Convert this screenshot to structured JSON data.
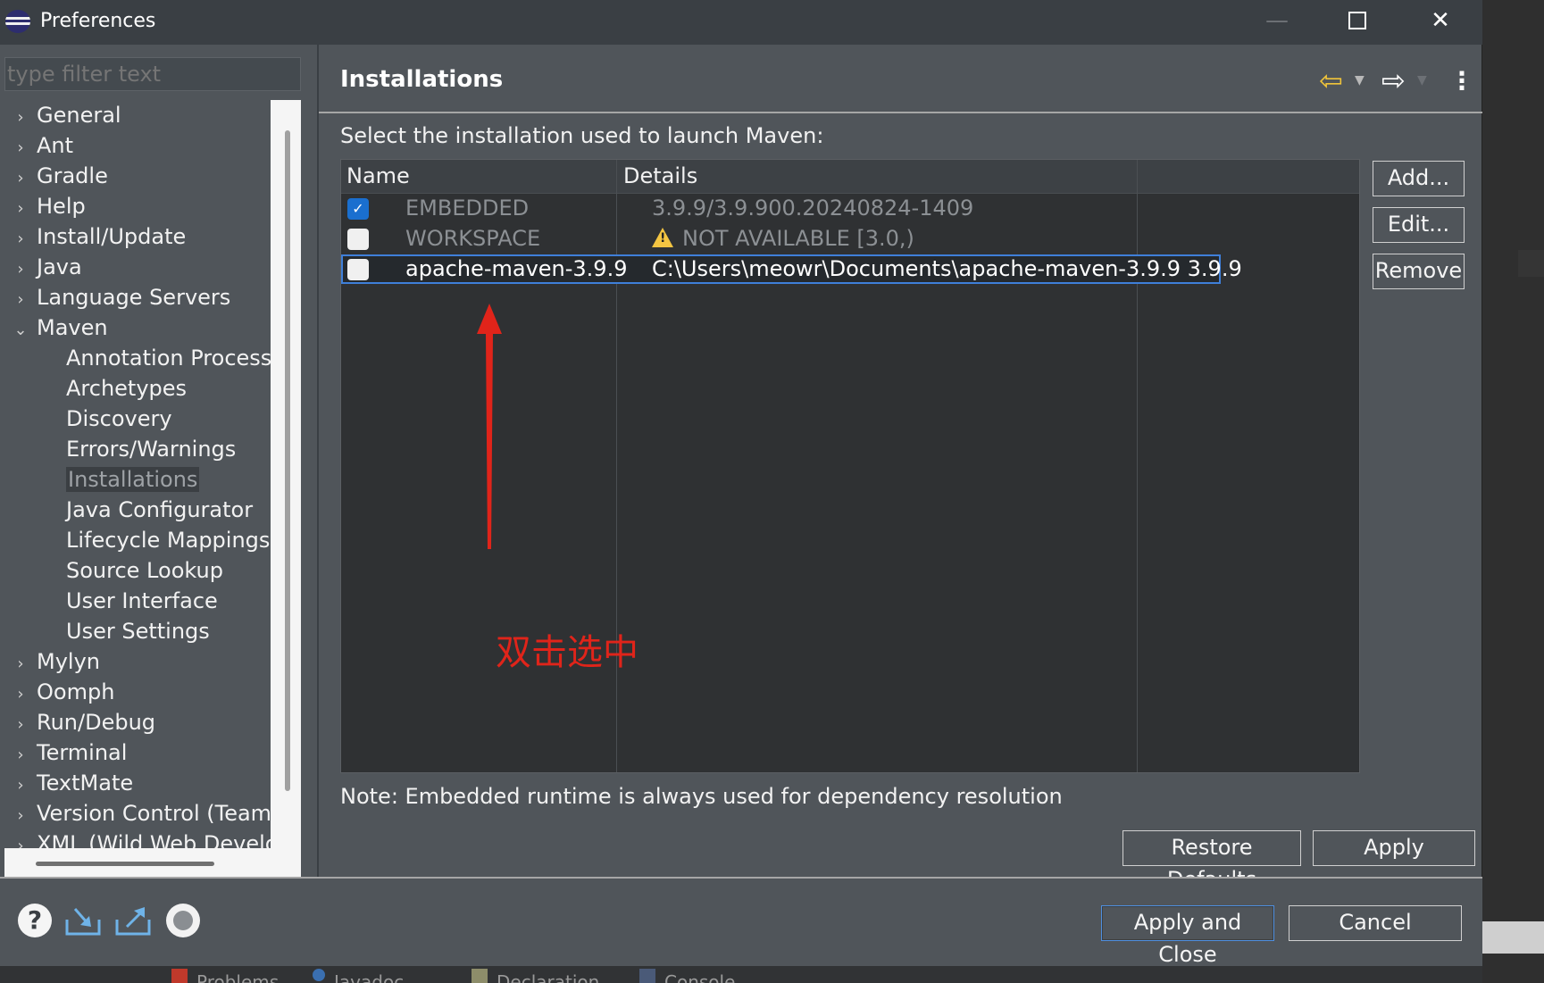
{
  "window": {
    "title": "Preferences"
  },
  "filter": {
    "placeholder": "type filter text"
  },
  "tree": {
    "items": [
      {
        "label": "General",
        "expandable": true
      },
      {
        "label": "Ant",
        "expandable": true
      },
      {
        "label": "Gradle",
        "expandable": true
      },
      {
        "label": "Help",
        "expandable": true
      },
      {
        "label": "Install/Update",
        "expandable": true
      },
      {
        "label": "Java",
        "expandable": true
      },
      {
        "label": "Language Servers",
        "expandable": true
      },
      {
        "label": "Maven",
        "expandable": true,
        "expanded": true
      },
      {
        "label": "Annotation Processi",
        "child": true
      },
      {
        "label": "Archetypes",
        "child": true
      },
      {
        "label": "Discovery",
        "child": true
      },
      {
        "label": "Errors/Warnings",
        "child": true
      },
      {
        "label": "Installations",
        "child": true,
        "selected": true
      },
      {
        "label": "Java Configurator",
        "child": true
      },
      {
        "label": "Lifecycle Mappings",
        "child": true
      },
      {
        "label": "Source Lookup",
        "child": true
      },
      {
        "label": "User Interface",
        "child": true
      },
      {
        "label": "User Settings",
        "child": true
      },
      {
        "label": "Mylyn",
        "expandable": true
      },
      {
        "label": "Oomph",
        "expandable": true
      },
      {
        "label": "Run/Debug",
        "expandable": true
      },
      {
        "label": "Terminal",
        "expandable": true
      },
      {
        "label": "TextMate",
        "expandable": true
      },
      {
        "label": "Version Control (Team)",
        "expandable": true
      },
      {
        "label": "XML (Wild Web Develo",
        "expandable": true
      }
    ]
  },
  "page": {
    "title": "Installations",
    "intro": "Select the installation used to launch Maven:",
    "note": "Note: Embedded runtime is always used for dependency resolution"
  },
  "table": {
    "columns": [
      "Name",
      "Details"
    ],
    "rows": [
      {
        "checked": true,
        "name": "EMBEDDED",
        "details": "3.9.9/3.9.900.20240824-1409",
        "warning": false
      },
      {
        "checked": false,
        "name": "WORKSPACE",
        "details": "NOT AVAILABLE [3.0,)",
        "warning": true
      },
      {
        "checked": false,
        "name": "apache-maven-3.9.9",
        "details": "C:\\Users\\meowr\\Documents\\apache-maven-3.9.9 3.9.9",
        "warning": false,
        "selected": true
      }
    ]
  },
  "side_buttons": {
    "add": "Add...",
    "edit": "Edit...",
    "remove": "Remove"
  },
  "buttons": {
    "restore_defaults": "Restore Defaults",
    "apply": "Apply",
    "apply_and_close": "Apply and Close",
    "cancel": "Cancel"
  },
  "annotation": {
    "text": "双击选中",
    "color": "#e0241a"
  },
  "background_tabs": [
    "Problems",
    "Javadoc",
    "Declaration",
    "Console"
  ]
}
